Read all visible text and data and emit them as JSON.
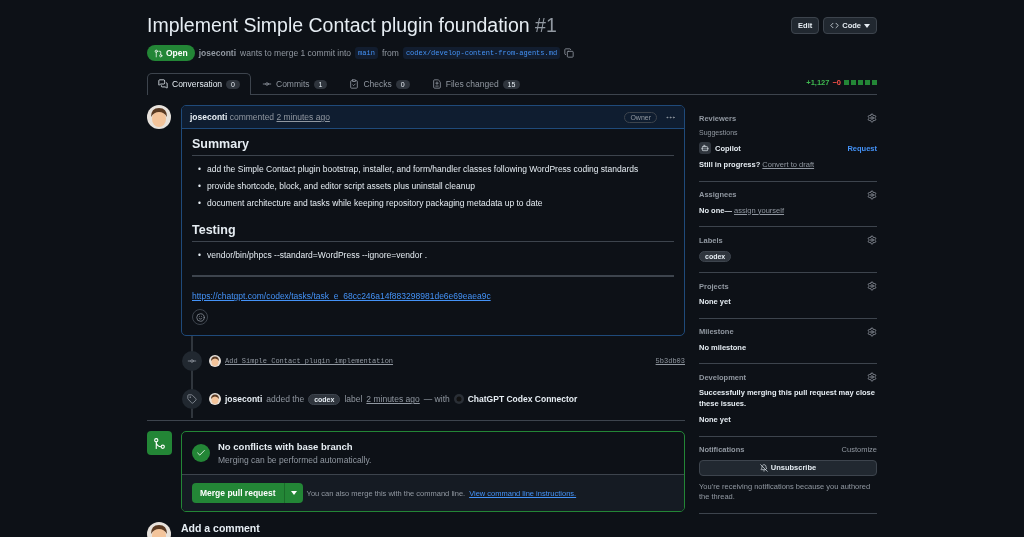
{
  "header": {
    "title": "Implement Simple Contact plugin foundation",
    "number": "#1",
    "buttons": [
      {
        "kind": "edit",
        "label": "Edit"
      },
      {
        "kind": "code",
        "label": "Code"
      }
    ]
  },
  "status": {
    "state": "Open",
    "author": "joseconti",
    "text_1": "wants to merge 1 commit into",
    "base": "main",
    "text_2": "from",
    "head": "codex/develop-content-from-agents.md"
  },
  "tabs": [
    {
      "kind": "conversation",
      "label": "Conversation",
      "count": "0",
      "selected": true
    },
    {
      "kind": "commits",
      "label": "Commits",
      "count": "1",
      "selected": false
    },
    {
      "kind": "checks",
      "label": "Checks",
      "count": "0",
      "selected": false
    },
    {
      "kind": "files",
      "label": "Files changed",
      "count": "15",
      "selected": false
    }
  ],
  "diffstat": {
    "additions": "+1,127",
    "deletions": "−0"
  },
  "comment": {
    "author": "joseconti",
    "action": "commented",
    "time": "2 minutes ago",
    "badge": "Owner",
    "sections": [
      {
        "heading": "Summary",
        "marker": "•",
        "items": [
          "add the Simple Contact plugin bootstrap, installer, and form/handler classes following WordPress coding standards",
          "provide shortcode, block, and editor script assets plus uninstall cleanup",
          "document architecture and tasks while keeping repository packaging metadata up to date"
        ]
      },
      {
        "heading": "Testing",
        "marker": "•",
        "items": [
          "vendor/bin/phpcs --standard=WordPress --ignore=vendor ."
        ]
      }
    ],
    "link": "https://chatgpt.com/codex/tasks/task_e_68cc246a14f883298981de6e69eaea9c"
  },
  "timeline": [
    {
      "kind": "commit",
      "message": "Add Simple Contact plugin implementation",
      "sha": "5b3db03"
    },
    {
      "kind": "label",
      "author": "joseconti",
      "text_1": "added the",
      "label": "codex",
      "text_2": "label",
      "time": "2 minutes ago",
      "text_3": "— with",
      "app": "ChatGPT Codex Connector"
    }
  ],
  "merge": {
    "title": "No conflicts with base branch",
    "subtitle": "Merging can be performed automatically.",
    "button": "Merge pull request",
    "hint": "You can also merge this with the command line.",
    "link": "View command line instructions."
  },
  "add_comment": {
    "title": "Add a comment"
  },
  "sidebar": [
    {
      "title": "Reviewers",
      "gear": true,
      "blocks": [
        {
          "kind": "subheading",
          "text": "Suggestions"
        },
        {
          "kind": "reviewer",
          "name": "Copilot",
          "action": "Request"
        },
        {
          "kind": "prompt",
          "text": "Still in progress?",
          "link": "Convert to draft"
        }
      ]
    },
    {
      "title": "Assignees",
      "gear": true,
      "blocks": [
        {
          "kind": "prompt",
          "text": "No one—",
          "link": "assign yourself"
        }
      ]
    },
    {
      "title": "Labels",
      "gear": true,
      "blocks": [
        {
          "kind": "label",
          "text": "codex"
        }
      ]
    },
    {
      "title": "Projects",
      "gear": true,
      "blocks": [
        {
          "kind": "text",
          "text": "None yet"
        }
      ]
    },
    {
      "title": "Milestone",
      "gear": true,
      "blocks": [
        {
          "kind": "text",
          "text": "No milestone"
        }
      ]
    },
    {
      "title": "Development",
      "gear": true,
      "blocks": [
        {
          "kind": "text",
          "text": "Successfully merging this pull request may close these issues."
        },
        {
          "kind": "text",
          "text": "None yet"
        }
      ]
    },
    {
      "title": "Notifications",
      "gear": false,
      "action": "Customize",
      "blocks": [
        {
          "kind": "button",
          "text": "Unsubscribe"
        },
        {
          "kind": "muted",
          "text": "You’re receiving notifications because you authored the thread."
        }
      ]
    }
  ]
}
